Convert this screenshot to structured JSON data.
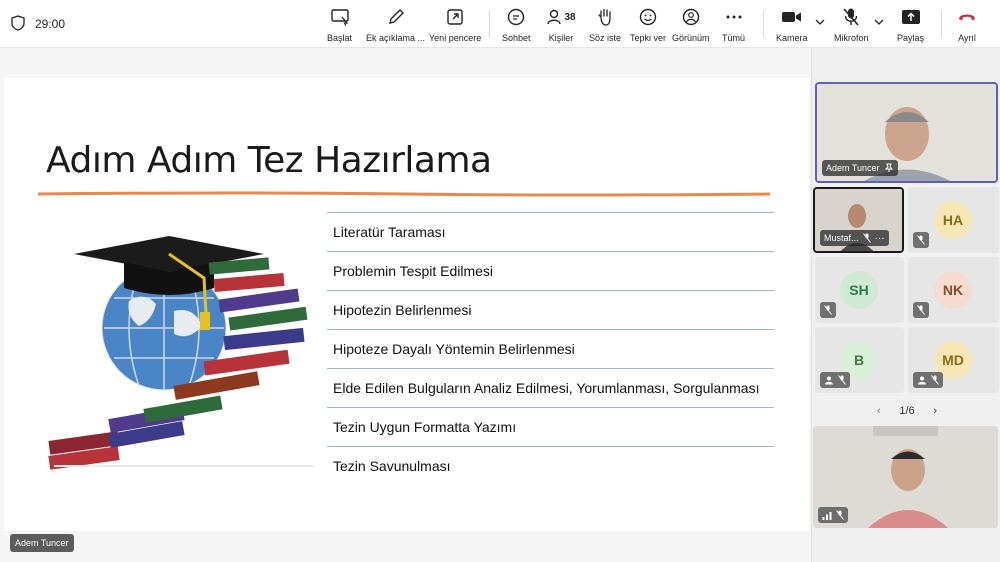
{
  "toolbar": {
    "timer": "29:00",
    "buttons": [
      {
        "label": "Başlat",
        "icon": "present-icon"
      },
      {
        "label": "Ek açıklama ...",
        "icon": "pen-icon"
      },
      {
        "label": "Yeni pencere",
        "icon": "popout-icon"
      },
      {
        "label": "Sohbet",
        "icon": "chat-icon"
      },
      {
        "label": "Kişiler",
        "icon": "people-icon",
        "count": "38"
      },
      {
        "label": "Söz iste",
        "icon": "hand-icon"
      },
      {
        "label": "Tepki ver",
        "icon": "emoji-icon"
      },
      {
        "label": "Görünüm",
        "icon": "view-icon"
      },
      {
        "label": "Tümü",
        "icon": "more-icon"
      },
      {
        "label": "Kamera",
        "icon": "camera-icon"
      },
      {
        "label": "Mikrofon",
        "icon": "mic-off-icon"
      },
      {
        "label": "Paylaş",
        "icon": "share-icon"
      },
      {
        "label": "Ayrıl",
        "icon": "hangup-icon"
      }
    ]
  },
  "slide": {
    "title": "Adım Adım Tez Hazırlama",
    "steps": [
      "Literatür Taraması",
      "Problemin Tespit Edilmesi",
      "Hipotezin Belirlenmesi",
      "Hipoteze Dayalı Yöntemin Belirlenmesi",
      "Elde Edilen Bulguların Analiz Edilmesi, Yorumlanması, Sorgulanması",
      "Tezin Uygun Formatta Yazımı",
      "Tezin Savunulması"
    ]
  },
  "presenter_label": "Adem Tuncer",
  "participants": {
    "main": {
      "name": "Adem Tuncer"
    },
    "video2": {
      "name": "Mustaf..."
    },
    "avatars": [
      {
        "initials": "HA",
        "color": "#f5e6b3",
        "text_color": "#8a6d1b"
      },
      {
        "initials": "SH",
        "color": "#cfe9d4",
        "text_color": "#2f7a43"
      },
      {
        "initials": "NK",
        "color": "#f6dcd0",
        "text_color": "#8a4a2f"
      },
      {
        "initials": "B",
        "color": "#d9efd9",
        "text_color": "#3b7b3b"
      },
      {
        "initials": "MD",
        "color": "#f5e6b3",
        "text_color": "#8a6d1b"
      }
    ],
    "pager": "1/6"
  },
  "colors": {
    "accent": "#5b5fc7",
    "hangup": "#c4314b",
    "orange_line": "#e8884a"
  }
}
